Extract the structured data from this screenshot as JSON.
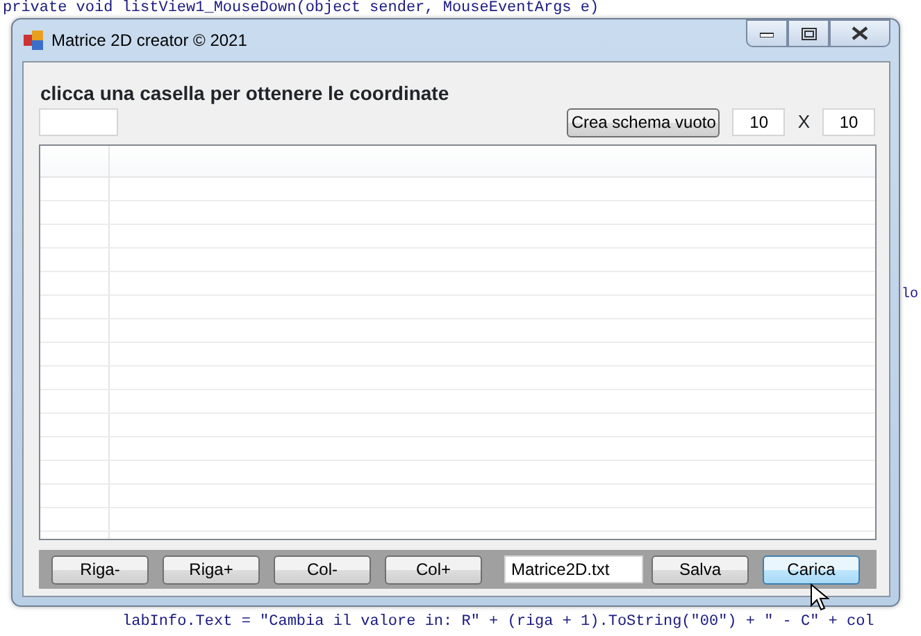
{
  "background_code": {
    "top_line": "private void listView1_MouseDown(object sender, MouseEventArgs e)",
    "bottom_line": "labInfo.Text = \"Cambia il valore in: R\" + (riga + 1).ToString(\"00\") + \" - C\" + col",
    "side_fragment": "lo"
  },
  "window": {
    "title": "Matrice 2D creator ©  2021"
  },
  "instruction": "clicca una casella per ottenere le coordinate",
  "create_button": "Crea schema vuoto",
  "rows_field": {
    "value": "10"
  },
  "separator": "X",
  "cols_field": {
    "value": "10"
  },
  "toolbar": [
    {
      "kind": "button",
      "label": "Riga-",
      "hovered": false
    },
    {
      "kind": "button",
      "label": "Riga+",
      "hovered": false
    },
    {
      "kind": "button",
      "label": "Col-",
      "hovered": false
    },
    {
      "kind": "button",
      "label": "Col+",
      "hovered": false
    },
    {
      "kind": "field",
      "value": "Matrice2D.txt"
    },
    {
      "kind": "button",
      "label": "Salva",
      "hovered": false
    },
    {
      "kind": "button",
      "label": "Carica",
      "hovered": true
    }
  ]
}
